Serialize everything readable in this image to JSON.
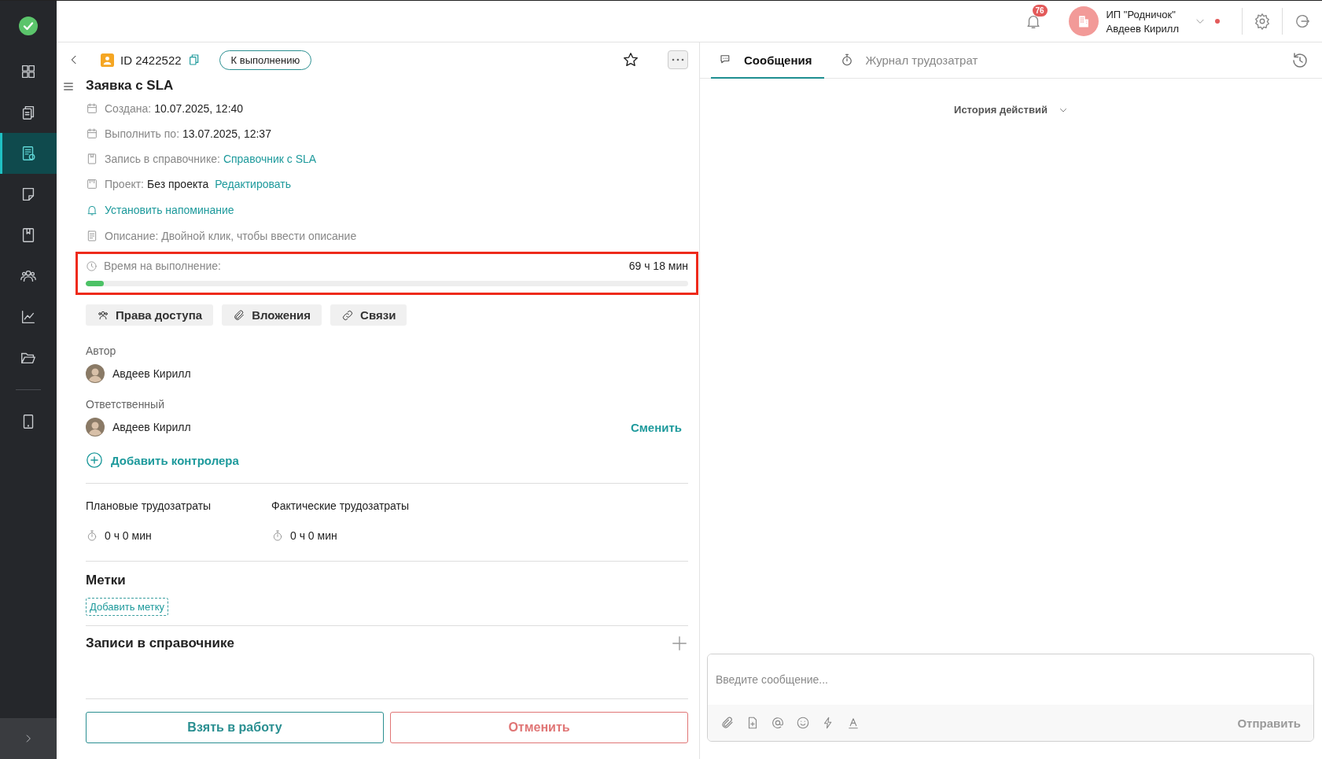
{
  "sidebar": {
    "items": [
      {
        "kind": "dashboard",
        "selected": false
      },
      {
        "kind": "documents",
        "selected": false
      },
      {
        "kind": "requests",
        "selected": true
      },
      {
        "kind": "notes",
        "selected": false
      },
      {
        "kind": "book",
        "selected": false
      },
      {
        "kind": "team",
        "selected": false
      },
      {
        "kind": "chart",
        "selected": false
      },
      {
        "kind": "folder",
        "selected": false
      },
      {
        "kind": "tablet",
        "selected": false
      }
    ]
  },
  "topbar": {
    "notifications": "76",
    "organization": "ИП \"Родничок\"",
    "user": "Авдеев Кирилл"
  },
  "task": {
    "id": "ID 2422522",
    "status": "К выполнению",
    "title": "Заявка с SLA",
    "fields": [
      {
        "kind": "date",
        "label": "Создана:",
        "value": "10.07.2025, 12:40"
      },
      {
        "kind": "date",
        "label": "Выполнить по:",
        "value": "13.07.2025, 12:37"
      },
      {
        "kind": "directory",
        "label": "Запись в справочнике:",
        "link": "Справочник с SLA"
      },
      {
        "kind": "project",
        "label": "Проект:",
        "value": "Без проекта",
        "link": "Редактировать"
      }
    ],
    "reminder": "Установить напоминание",
    "description": "Описание: Двойной клик, чтобы ввести описание",
    "time": {
      "label": "Время на выполнение:",
      "value": "69 ч 18 мин",
      "level": 0.03,
      "highlighted": true
    },
    "buttons": [
      {
        "kind": "access",
        "label": "Права доступа"
      },
      {
        "kind": "attachments",
        "label": "Вложения"
      },
      {
        "kind": "links",
        "label": "Связи"
      }
    ],
    "author": {
      "label": "Автор",
      "name": "Авдеев Кирилл"
    },
    "responsible": {
      "label": "Ответственный",
      "name": "Авдеев Кирилл",
      "action": "Сменить"
    },
    "add_controller": "Добавить контролера",
    "efforts": [
      {
        "label": "Плановые трудозатраты",
        "value": "0 ч 0 мин"
      },
      {
        "label": "Фактические трудозатраты",
        "value": "0 ч 0 мин"
      }
    ],
    "tags": {
      "title": "Метки",
      "add": "Добавить метку"
    },
    "records": {
      "title": "Записи в справочнике"
    },
    "actions": {
      "take": "Взять в работу",
      "cancel": "Отменить"
    }
  },
  "chat": {
    "tabs": [
      {
        "kind": "messages",
        "label": "Сообщения",
        "selected": true
      },
      {
        "kind": "timer",
        "label": "Журнал трудозатрат",
        "selected": false
      }
    ],
    "history": "История действий",
    "placeholder": "Введите сообщение...",
    "send": "Отправить"
  }
}
